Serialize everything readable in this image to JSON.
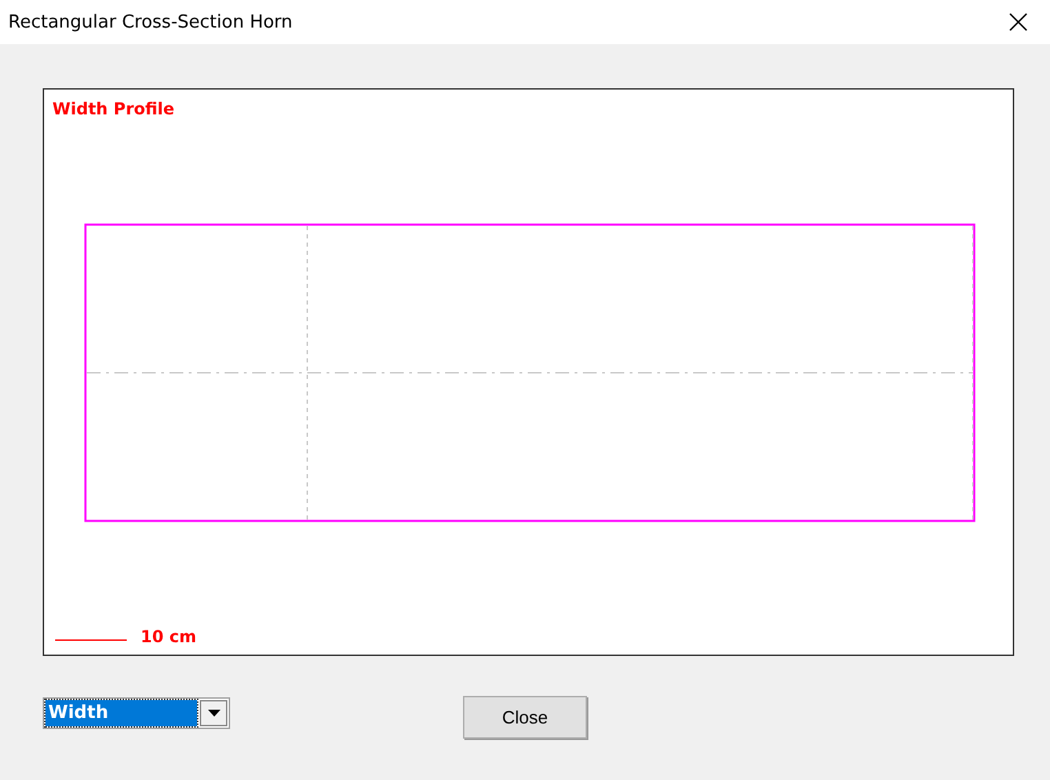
{
  "window": {
    "title": "Rectangular Cross-Section Horn"
  },
  "plot": {
    "title": "Width Profile",
    "scale_label": "10 cm"
  },
  "dropdown": {
    "value": "Width"
  },
  "buttons": [
    "Close"
  ]
}
